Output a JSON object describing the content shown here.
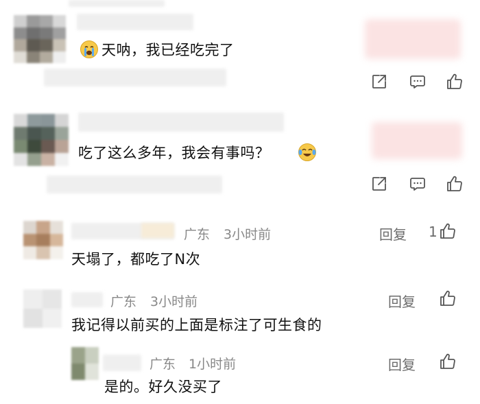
{
  "comments": [
    {
      "text": "天呐，我已经吃完了",
      "emoji_icon": "crying-face-icon",
      "icons": [
        "share-icon",
        "comment-bubble-icon",
        "thumbs-up-icon"
      ]
    },
    {
      "text": "吃了这么多年，我会有事吗？",
      "emoji_icon": "crying-laughing-face-icon",
      "icons": [
        "share-icon",
        "comment-bubble-icon",
        "thumbs-up-icon"
      ]
    }
  ],
  "replies": [
    {
      "location": "广东",
      "time": "3小时前",
      "text": "天塌了，都吃了N次",
      "reply_label": "回复",
      "like_count": "1"
    },
    {
      "location": "广东",
      "time": "3小时前",
      "text": "我记得以前买的上面是标注了可生食的",
      "reply_label": "回复",
      "like_count": ""
    },
    {
      "location": "广东",
      "time": "1小时前",
      "text": "是的。好久没买了",
      "reply_label": "回复",
      "like_count": ""
    }
  ],
  "colors": {
    "text": "#111111",
    "meta": "#888888",
    "icon": "#555555"
  }
}
